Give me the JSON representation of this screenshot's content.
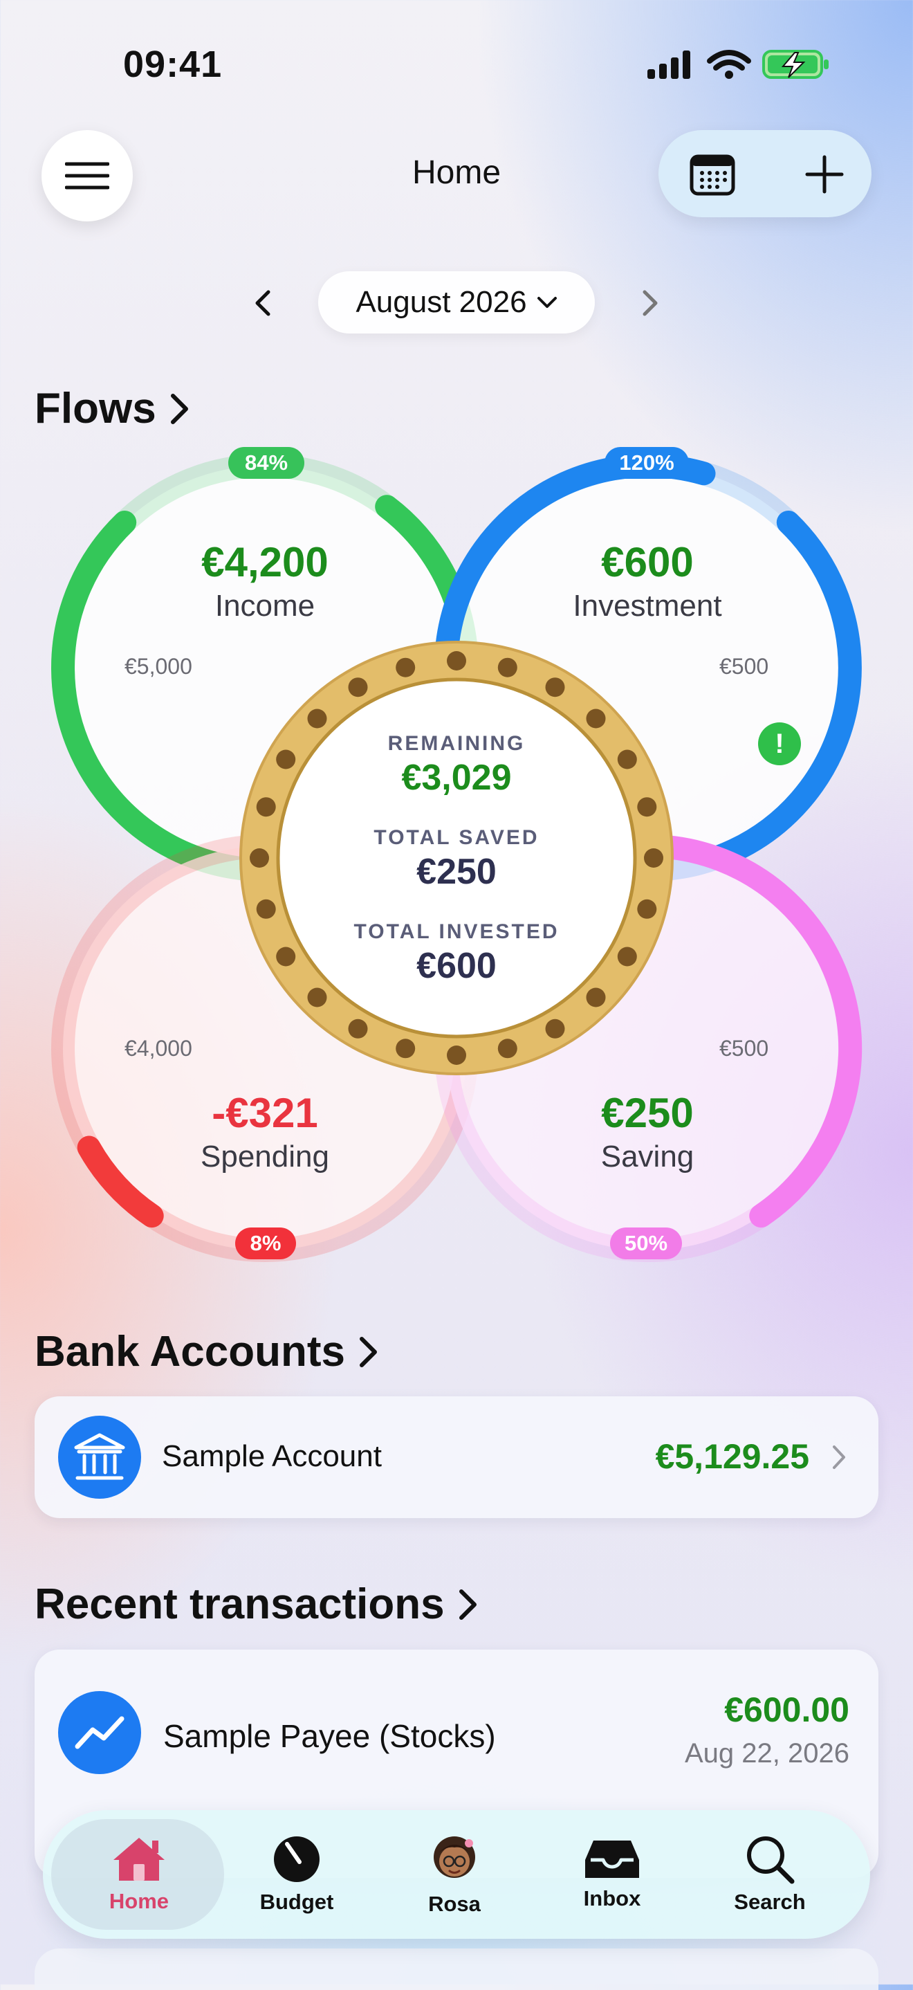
{
  "status_bar": {
    "time": "09:41"
  },
  "nav": {
    "title": "Home"
  },
  "month_selector": {
    "label": "August 2026"
  },
  "flows": {
    "header": "Flows",
    "income": {
      "amount": "€4,200",
      "label": "Income",
      "target": "€5,000",
      "percent_label": "84%",
      "progress": 0.84,
      "color": "#34c759"
    },
    "investment": {
      "amount": "€600",
      "label": "Investment",
      "target": "€500",
      "percent_label": "120%",
      "progress": 1.2,
      "color": "#1e86f0"
    },
    "spending": {
      "amount": "-€321",
      "label": "Spending",
      "target": "€4,000",
      "percent_label": "8%",
      "progress": 0.08,
      "color": "#f23b3b"
    },
    "saving": {
      "amount": "€250",
      "label": "Saving",
      "target": "€500",
      "percent_label": "50%",
      "progress": 0.5,
      "color": "#f47ff0"
    },
    "center": {
      "remaining_label": "REMAINING",
      "remaining_value": "€3,029",
      "saved_label": "TOTAL SAVED",
      "saved_value": "€250",
      "invested_label": "TOTAL INVESTED",
      "invested_value": "€600"
    }
  },
  "bank_accounts": {
    "header": "Bank Accounts",
    "items": [
      {
        "name": "Sample Account",
        "balance": "€5,129.25",
        "icon": "bank-icon"
      }
    ]
  },
  "recent_transactions": {
    "header": "Recent transactions",
    "items": [
      {
        "payee": "Sample Payee (Stocks)",
        "amount": "€600.00",
        "date": "Aug 22, 2026",
        "icon": "trend-up-icon"
      }
    ]
  },
  "tabbar": {
    "items": [
      {
        "label": "Home",
        "icon": "house-icon",
        "active": true
      },
      {
        "label": "Budget",
        "icon": "gauge-icon",
        "active": false
      },
      {
        "label": "Rosa",
        "icon": "avatar-icon",
        "active": false
      },
      {
        "label": "Inbox",
        "icon": "tray-icon",
        "active": false
      },
      {
        "label": "Search",
        "icon": "magnifier-icon",
        "active": false
      }
    ]
  },
  "colors": {
    "positive": "#1c8c1c",
    "negative": "#e9343f",
    "accent": "#1e7bf2",
    "active_tab": "#d8436b"
  }
}
